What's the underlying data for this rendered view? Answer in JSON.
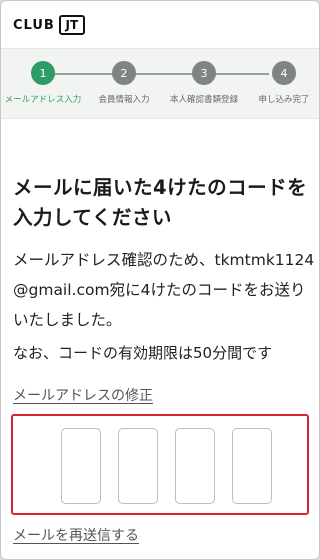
{
  "header": {
    "logo_text": "CLUB",
    "logo_mark": "JT"
  },
  "steps": [
    {
      "number": "1",
      "label": "メールアドレス入力",
      "active": true
    },
    {
      "number": "2",
      "label": "会員情報入力",
      "active": false
    },
    {
      "number": "3",
      "label": "本人確認書類登録",
      "active": false
    },
    {
      "number": "4",
      "label": "申し込み完了",
      "active": false
    }
  ],
  "main": {
    "title": "メールに届いた4けたのコードを入力してください",
    "description": "メールアドレス確認のため、tkmtmk1124@gmail.com宛に4けたのコードをお送りいたしました。",
    "note": "なお、コードの有効期限は50分間です",
    "edit_email_link": "メールアドレスの修正",
    "resend_link": "メールを再送信する"
  },
  "code_inputs": [
    "",
    "",
    "",
    ""
  ],
  "colors": {
    "accent_green": "#2e9c66",
    "step_inactive": "#7f8580",
    "highlight_red": "#d9262b"
  }
}
